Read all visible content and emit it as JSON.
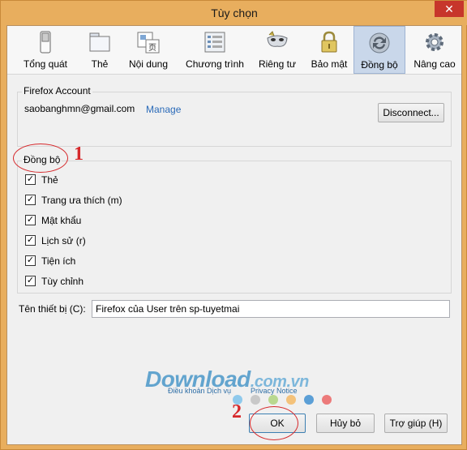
{
  "window": {
    "title": "Tùy chọn",
    "close_label": "✕"
  },
  "tabs": [
    {
      "label": "Tổng quát"
    },
    {
      "label": "Thẻ"
    },
    {
      "label": "Nội dung"
    },
    {
      "label": "Chương trình"
    },
    {
      "label": "Riêng tư"
    },
    {
      "label": "Bảo mật"
    },
    {
      "label": "Đồng bộ"
    },
    {
      "label": "Nâng cao"
    }
  ],
  "selected_tab": "Đồng bộ",
  "account": {
    "group_label": "Firefox Account",
    "email": "saobanghmn@gmail.com",
    "manage_label": "Manage",
    "disconnect_label": "Disconnect..."
  },
  "sync": {
    "group_label": "Đồng bộ",
    "items": [
      {
        "label": "Thẻ",
        "checked": true
      },
      {
        "label": "Trang ưa thích (m)",
        "checked": true
      },
      {
        "label": "Mật khẩu",
        "checked": true
      },
      {
        "label": "Lịch sử (r)",
        "checked": true
      },
      {
        "label": "Tiện ích",
        "checked": true
      },
      {
        "label": "Tùy chỉnh",
        "checked": true
      }
    ]
  },
  "device": {
    "label": "Tên thiết bị (C):",
    "value": "Firefox của User trên sp-tuyetmai"
  },
  "buttons": {
    "ok": "OK",
    "cancel": "Hủy bỏ",
    "help": "Trợ giúp (H)"
  },
  "annotations": {
    "one": "1",
    "two": "2"
  },
  "watermark": {
    "brand": "Download",
    "domain": ".com.vn",
    "terms": "Điều khoản Dịch vụ",
    "privacy": "Privacy Notice",
    "dot_colors": [
      "#8fc9ec",
      "#c8c8c8",
      "#b9d88f",
      "#f4c27a",
      "#5b9fd6",
      "#ec7a7a"
    ]
  },
  "colors": {
    "accent_selected_tab": "#c9d7ea",
    "link": "#2a6ab8",
    "annotation": "#d6282b",
    "titlebar": "#e8ae5e"
  }
}
